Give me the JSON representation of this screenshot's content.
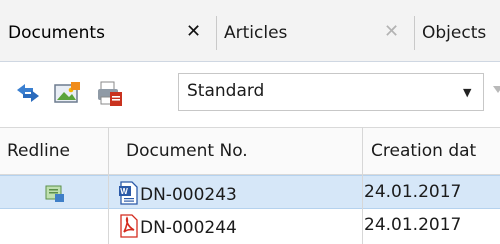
{
  "tabs": [
    {
      "label": "Documents",
      "active": true,
      "close_glyph": "✕"
    },
    {
      "label": "Articles",
      "active": false,
      "close_glyph": "✕"
    },
    {
      "label": "Objects",
      "active": false,
      "close_glyph": ""
    }
  ],
  "toolbar": {
    "icons": [
      "refresh-arrows-icon",
      "picture-icon",
      "print-icon"
    ],
    "view_combo": {
      "value": "Standard",
      "arrow": "▼"
    }
  },
  "grid": {
    "columns": [
      "Redline",
      "Document No.",
      "Creation dat"
    ],
    "rows": [
      {
        "redline_icon": "redline-doc-icon",
        "type_icon": "word-doc-icon",
        "doc_no": "DN-000243",
        "created": "24.01.2017",
        "selected": true
      },
      {
        "redline_icon": "",
        "type_icon": "pdf-doc-icon",
        "doc_no": "DN-000244",
        "created": "24.01.2017",
        "selected": false
      }
    ]
  },
  "colors": {
    "selection": "#d6e7f8",
    "tabbar": "#f3f3f3",
    "pdf": "#d42b1e",
    "word": "#2c5aa8"
  }
}
